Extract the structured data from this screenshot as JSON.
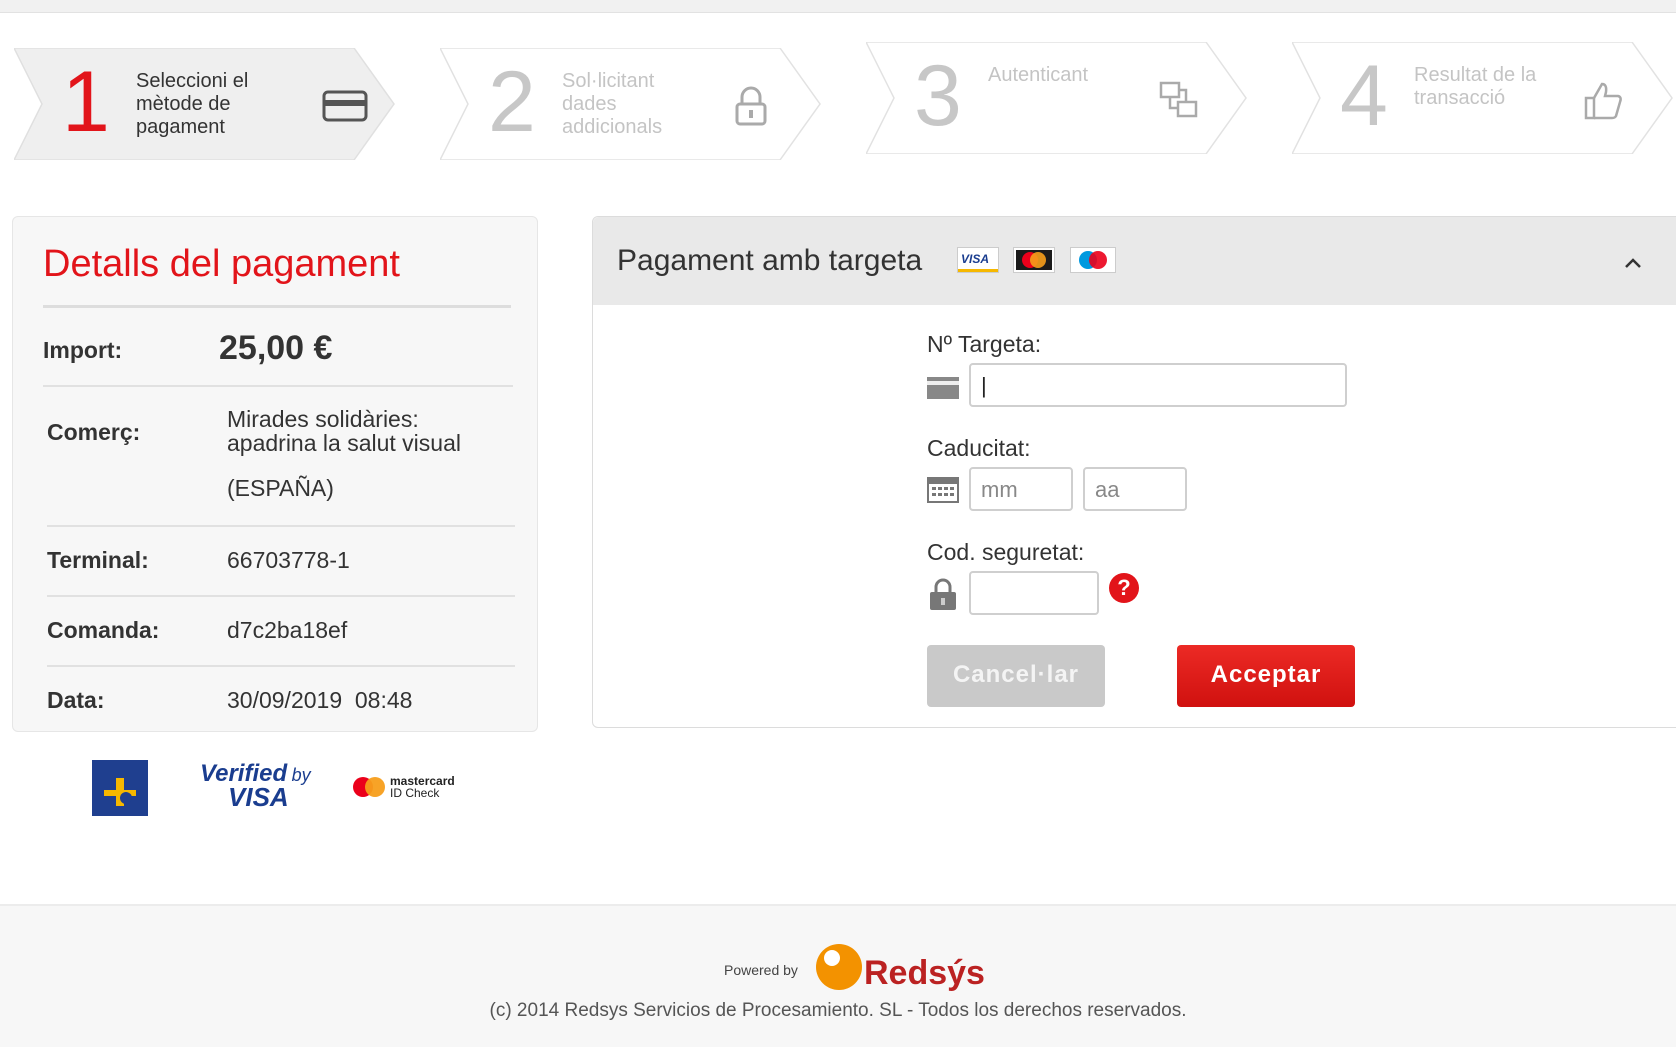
{
  "steps": [
    {
      "number": "1",
      "label": "Seleccioni el mètode de pagament",
      "icon": "credit-card-icon",
      "state": "active"
    },
    {
      "number": "2",
      "label": "Sol·licitant dades addicionals",
      "icon": "lock-icon",
      "state": "inactive"
    },
    {
      "number": "3",
      "label": "Autenticant",
      "icon": "authentication-icon",
      "state": "inactive"
    },
    {
      "number": "4",
      "label": "Resultat de la transacció",
      "icon": "thumbs-up-icon",
      "state": "inactive"
    }
  ],
  "details": {
    "title": "Detalls del pagament",
    "rows": [
      {
        "key": "Import:",
        "value": "25,00 €"
      },
      {
        "key": "Comerç:",
        "value": "Mirades solidàries: apadrina la salut visual",
        "value2": "(ESPAÑA)"
      },
      {
        "key": "Terminal:",
        "value": "66703778-1"
      },
      {
        "key": "Comanda:",
        "value": "d7c2ba18ef"
      },
      {
        "key": "Data:",
        "value": "30/09/2019  08:48"
      }
    ]
  },
  "seals": {
    "verified_by": "Verified",
    "verified_by_small": "by",
    "visa": "VISA",
    "mastercard": "mastercard",
    "idcheck": "ID Check"
  },
  "card": {
    "title": "Pagament amb targeta",
    "card_logos": [
      "VISA",
      "MasterCard",
      "Maestro"
    ],
    "number_label": "Nº Targeta:",
    "number_value": "|",
    "expiry_label": "Caducitat:",
    "month_placeholder": "mm",
    "year_placeholder": "aa",
    "cvv_label": "Cod. seguretat:",
    "help_icon": "?",
    "cancel_label": "Cancel·lar",
    "accept_label": "Acceptar"
  },
  "footer": {
    "powered_by": "Powered by",
    "brand": "Redsýs",
    "copyright": "(c) 2014 Redsys Servicios de Procesamiento. SL - Todos los derechos reservados."
  },
  "colors": {
    "accent": "#e2141a",
    "panel_bg": "#f7f7f7",
    "header_bg": "#e9e9e9"
  }
}
